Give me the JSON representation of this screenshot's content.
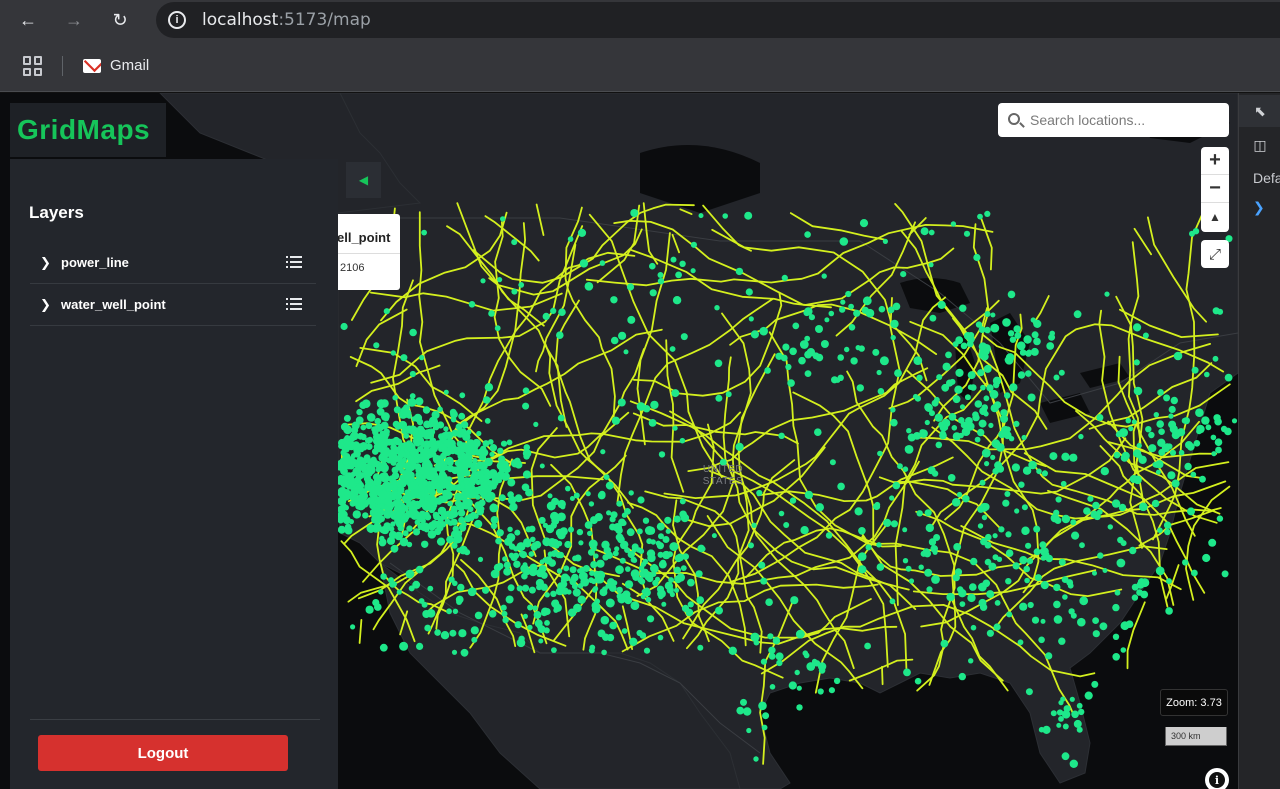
{
  "browser": {
    "url_host": "localhost",
    "url_rest": ":5173/map",
    "bookmarks": [
      {
        "label": "Gmail"
      }
    ]
  },
  "app": {
    "logo": "GridMaps",
    "layers_title": "Layers",
    "layers": [
      {
        "name": "power_line"
      },
      {
        "name": "water_well_point"
      }
    ],
    "logout_label": "Logout"
  },
  "map": {
    "country_label_1": "UNITED",
    "country_label_2": "STATES",
    "popup": {
      "title": "ell_point",
      "value": "2106"
    },
    "search_placeholder": "Search locations...",
    "zoom_label": "Zoom: 3.73",
    "scale_label": "300 km",
    "colors": {
      "power_line": "#d4f01e",
      "water_well_point": "#1ee88a",
      "background": "#0b0c0e"
    }
  },
  "devtools": {
    "tab_text": "Defa"
  }
}
